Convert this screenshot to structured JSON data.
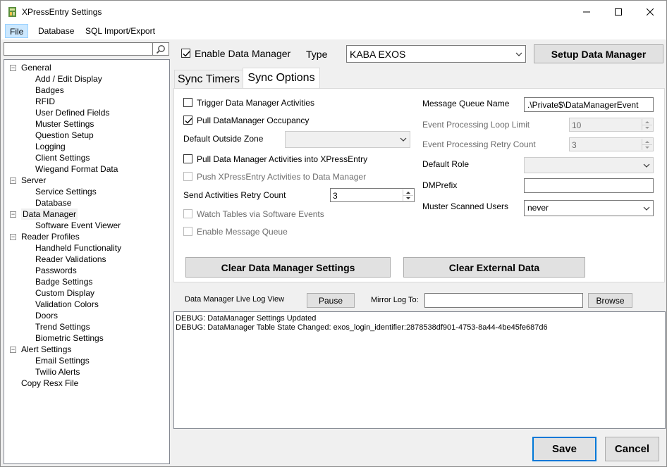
{
  "window": {
    "title": "XPressEntry Settings"
  },
  "menu": [
    "File",
    "Database",
    "SQL Import/Export"
  ],
  "search": {
    "value": ""
  },
  "tree": [
    {
      "label": "General",
      "level": 0,
      "expander": "−"
    },
    {
      "label": "Add / Edit Display",
      "level": 1
    },
    {
      "label": "Badges",
      "level": 1
    },
    {
      "label": "RFID",
      "level": 1
    },
    {
      "label": "User Defined Fields",
      "level": 1
    },
    {
      "label": "Muster Settings",
      "level": 1
    },
    {
      "label": "Question Setup",
      "level": 1
    },
    {
      "label": "Logging",
      "level": 1
    },
    {
      "label": "Client Settings",
      "level": 1
    },
    {
      "label": "Wiegand Format Data",
      "level": 1
    },
    {
      "label": "Server",
      "level": 0,
      "expander": "−"
    },
    {
      "label": "Service Settings",
      "level": 1
    },
    {
      "label": "Database",
      "level": 1
    },
    {
      "label": "Data Manager",
      "level": 0,
      "expander": "−",
      "selected": true
    },
    {
      "label": "Software Event Viewer",
      "level": 1
    },
    {
      "label": "Reader Profiles",
      "level": 0,
      "expander": "−"
    },
    {
      "label": "Handheld Functionality",
      "level": 1
    },
    {
      "label": "Reader Validations",
      "level": 1
    },
    {
      "label": "Passwords",
      "level": 1
    },
    {
      "label": "Badge Settings",
      "level": 1
    },
    {
      "label": "Custom Display",
      "level": 1
    },
    {
      "label": "Validation Colors",
      "level": 1
    },
    {
      "label": "Doors",
      "level": 1
    },
    {
      "label": "Trend Settings",
      "level": 1
    },
    {
      "label": "Biometric Settings",
      "level": 1
    },
    {
      "label": "Alert Settings",
      "level": 0,
      "expander": "−"
    },
    {
      "label": "Email Settings",
      "level": 1
    },
    {
      "label": "Twilio Alerts",
      "level": 1
    },
    {
      "label": "Copy Resx File",
      "level": 0
    }
  ],
  "top": {
    "enable_label": "Enable Data Manager",
    "enable_checked": true,
    "type_label": "Type",
    "type_value": "KABA EXOS",
    "setup_button": "Setup Data Manager"
  },
  "tabs": [
    {
      "label": "Sync Timers",
      "active": false
    },
    {
      "label": "Sync Options",
      "active": true
    }
  ],
  "sync_options": {
    "trigger_label": "Trigger Data Manager Activities",
    "pull_occupancy_label": "Pull DataManager Occupancy",
    "default_zone_label": "Default Outside Zone",
    "default_zone_value": "",
    "pull_activities_label": "Pull Data Manager Activities into XPressEntry",
    "push_activities_label": "Push XPressEntry Activities to Data Manager",
    "retry_count_label": "Send Activities Retry Count",
    "retry_count_value": "3",
    "watch_tables_label": "Watch Tables via Software Events",
    "enable_mq_label": "Enable Message Queue",
    "mq_name_label": "Message Queue Name",
    "mq_name_value": ".\\Private$\\DataManagerEvent",
    "loop_limit_label": "Event Processing Loop Limit",
    "loop_limit_value": "10",
    "retry_label": "Event Processing Retry Count",
    "retry_value": "3",
    "default_role_label": "Default Role",
    "default_role_value": "",
    "dmprefix_label": "DMPrefix",
    "dmprefix_value": "",
    "muster_label": "Muster Scanned Users",
    "muster_value": "never",
    "clear_dm_button": "Clear Data Manager Settings",
    "clear_ext_button": "Clear External Data"
  },
  "log": {
    "title": "Data Manager Live Log View",
    "pause_button": "Pause",
    "mirror_label": "Mirror Log To:",
    "mirror_value": "",
    "browse_button": "Browse",
    "lines": [
      "DEBUG: DataManager Settings Updated",
      "DEBUG: DataManager Table State Changed: exos_login_identifier:2878538df901-4753-8a44-4be45fe687d6"
    ]
  },
  "footer": {
    "save_button": "Save",
    "cancel_button": "Cancel"
  }
}
